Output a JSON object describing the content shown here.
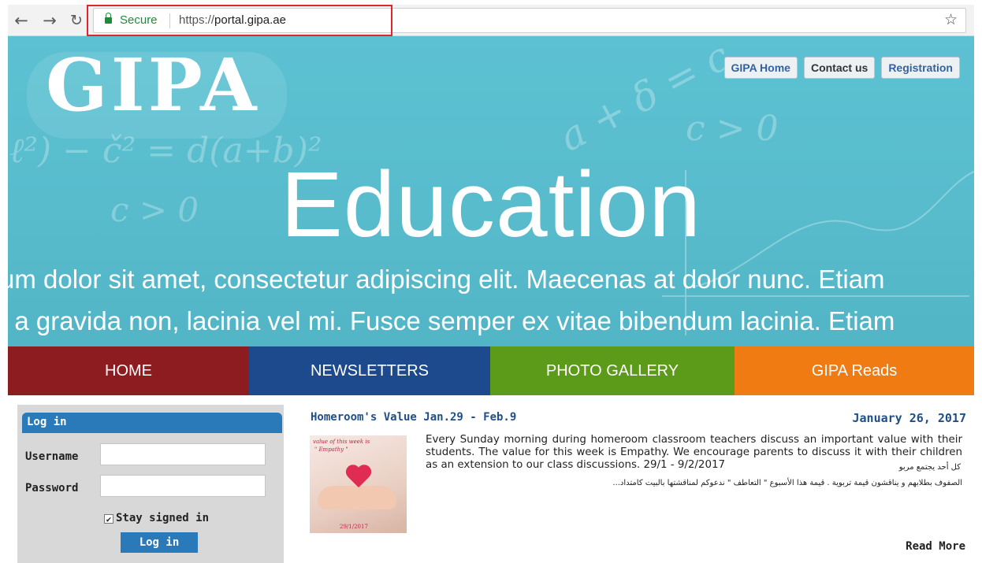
{
  "browser": {
    "back_icon": "arrow-left-icon",
    "forward_icon": "arrow-right-icon",
    "reload_icon": "reload-icon",
    "secure_label": "Secure",
    "url_scheme": "https://",
    "url_host": "portal.gipa.ae",
    "star_icon": "star-icon",
    "highlight_color": "#e1252b"
  },
  "banner": {
    "logo": "GIPA",
    "top_links": [
      "GIPA Home",
      "Contact us",
      "Registration"
    ],
    "hero_text": "Education",
    "lorem_line1": "um dolor sit amet, consectetur adipiscing elit. Maecenas at dolor nunc. Etiam",
    "lorem_line2": "t a gravida non, lacinia vel mi. Fusce semper ex vitae bibendum lacinia. Etiam",
    "background_color": "#5cc1d2"
  },
  "menu": [
    {
      "label": "HOME",
      "color": "#8c1c1f"
    },
    {
      "label": "NEWSLETTERS",
      "color": "#1d4a8c"
    },
    {
      "label": "PHOTO GALLERY",
      "color": "#5c9a19"
    },
    {
      "label": "GIPA Reads",
      "color": "#f07b13"
    }
  ],
  "login": {
    "title": "Log in",
    "username_label": "Username",
    "username_value": "",
    "password_label": "Password",
    "password_value": "",
    "stay_signed_in": "Stay signed in",
    "stay_checked": true,
    "button_label": "Log in",
    "accent_color": "#2a79b8"
  },
  "news": {
    "title": "Homeroom's Value Jan.29 - Feb.9",
    "date": "January 26, 2017",
    "thumb_line1": "value of this week is",
    "thumb_line2": "\" Empathy \"",
    "thumb_date": "29/1/2017",
    "body": "Every Sunday morning during homeroom classroom teachers discuss an important value with their students. The value for this week is Empathy. We encourage parents to discuss it with their children as an extension to our class discussions. 29/1 - 9/2/2017",
    "body_ar_line1": "كل أحد يجتمع مربو",
    "body_ar_line2": "الصفوف بطلابهم و يناقشون قيمة تربوية . قيمة هذا الأسبوع \" التعاطف \" ندعوكم لمناقشتها بالبيت كامتداد...",
    "read_more": "Read More"
  }
}
